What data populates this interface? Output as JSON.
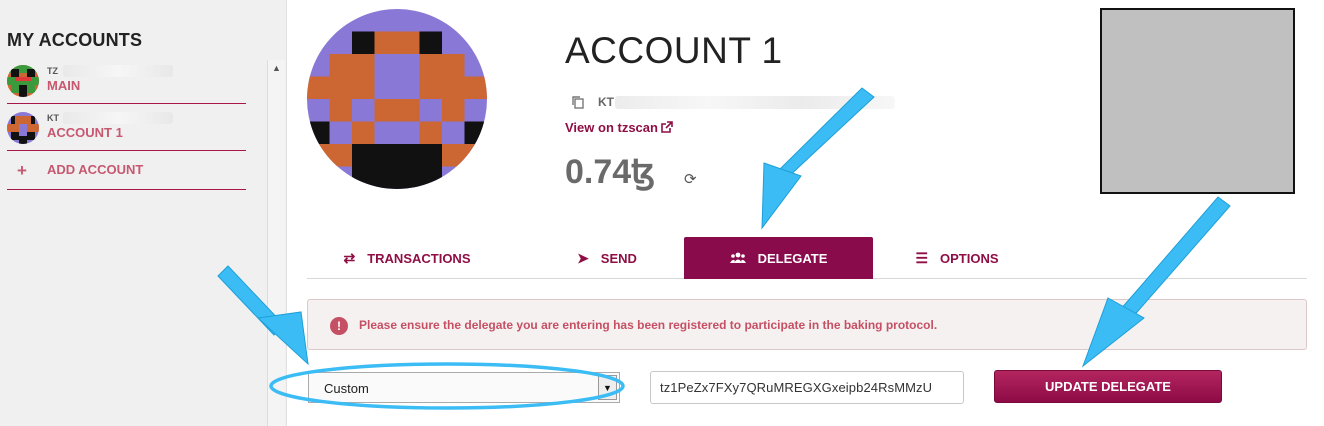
{
  "sidebar": {
    "title": "MY ACCOUNTS",
    "accounts": [
      {
        "address_prefix": "TZ",
        "name": "MAIN"
      },
      {
        "address_prefix": "KT",
        "name": "ACCOUNT 1"
      }
    ],
    "add_account_label": "ADD ACCOUNT",
    "add_icon": "+"
  },
  "account": {
    "title": "ACCOUNT 1",
    "address_prefix": "KT",
    "tzscan_label": "View on tzscan",
    "balance": "0.74ꜩ",
    "refresh_icon": "⟳"
  },
  "tabs": [
    {
      "label": "TRANSACTIONS",
      "icon": "⇄",
      "active": false
    },
    {
      "label": "SEND",
      "icon": "➤",
      "active": false
    },
    {
      "label": "DELEGATE",
      "icon": "👥",
      "active": true
    },
    {
      "label": "OPTIONS",
      "icon": "☰",
      "active": false
    }
  ],
  "alert": {
    "icon": "!",
    "text": "Please ensure the delegate you are entering has been registered to participate in the baking protocol."
  },
  "delegate_form": {
    "select_value": "Custom",
    "select_arrow": "▼",
    "delegate_address": "tz1PeZx7FXy7QRuMREGXGxeipb24RsMMzU",
    "update_button_label": "UPDATE DELEGATE"
  },
  "colors": {
    "brand": "#8a0b4c",
    "link": "#8f0f45",
    "alert_text": "#c55064",
    "annotation_arrow": "#3bbcf5"
  }
}
